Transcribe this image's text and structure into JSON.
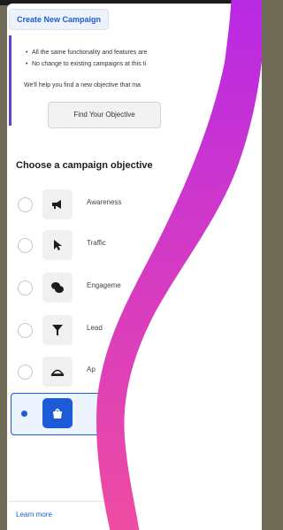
{
  "header": {
    "create_campaign_label": "Create New Campaign"
  },
  "notice": {
    "bullets": [
      "All the same functionality and features are",
      "No change to existing campaigns at this ti"
    ],
    "help_text": "We'll help you find a new objective that ma",
    "find_objective_label": "Find Your Objective"
  },
  "objectives": {
    "title": "Choose a campaign objective",
    "options": [
      {
        "label": "Awareness",
        "icon": "megaphone-icon",
        "selected": false
      },
      {
        "label": "Traffic",
        "icon": "cursor-icon",
        "selected": false
      },
      {
        "label": "Engageme",
        "icon": "chat-bubbles-icon",
        "selected": false
      },
      {
        "label": "Lead",
        "icon": "funnel-icon",
        "selected": false
      },
      {
        "label": "Ap",
        "icon": "app-promotion-icon",
        "selected": false
      },
      {
        "label": "",
        "icon": "sales-bag-icon",
        "selected": true
      }
    ]
  },
  "footer": {
    "learn_more_label": "Learn more"
  },
  "colors": {
    "accent": "#1d5bd6",
    "notice_bar": "#5b47d6",
    "swoosh_start": "#b829e6",
    "swoosh_end": "#f04ca0",
    "backdrop": "#6e6a55"
  }
}
